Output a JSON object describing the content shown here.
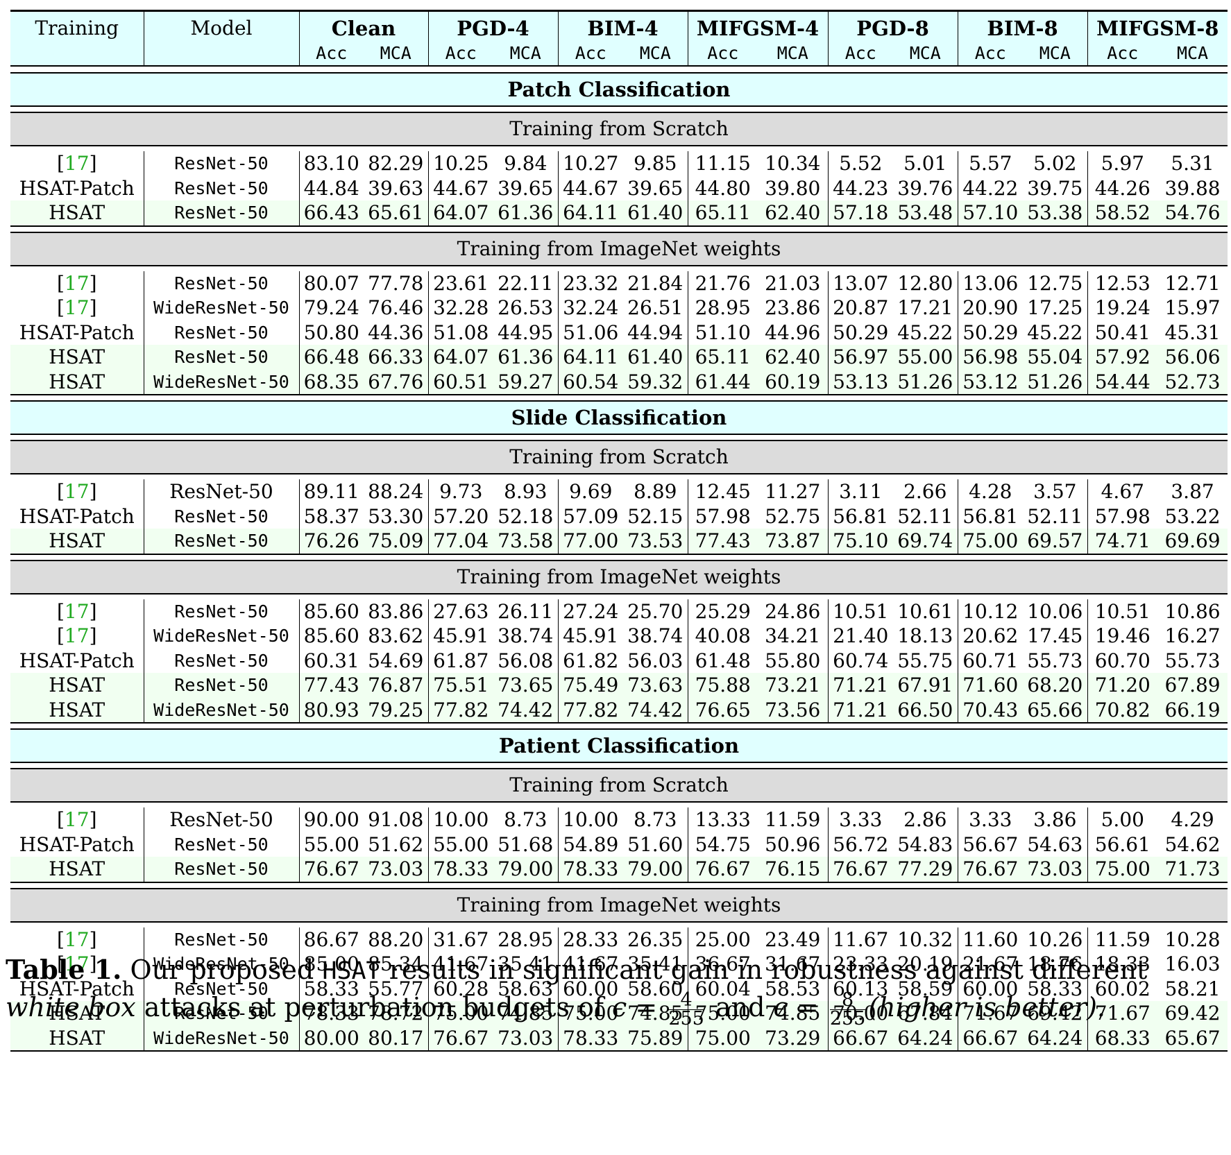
{
  "header": {
    "training_label": "Training",
    "model_label": "Model",
    "attacks": [
      "Clean",
      "PGD-4",
      "BIM-4",
      "MIFGSM-4",
      "PGD-8",
      "BIM-8",
      "MIFGSM-8"
    ],
    "metric_acc": "Acc",
    "metric_mca": "MCA"
  },
  "sections": [
    {
      "title": "Patch Classification",
      "groups": [
        {
          "title": "Training from Scratch",
          "rows": [
            {
              "training": "[17]",
              "cite": true,
              "model": "ResNet-50",
              "model_serif": false,
              "highlight": false,
              "values": [
                "83.10",
                "82.29",
                "10.25",
                "9.84",
                "10.27",
                "9.85",
                "11.15",
                "10.34",
                "5.52",
                "5.01",
                "5.57",
                "5.02",
                "5.97",
                "5.31"
              ]
            },
            {
              "training": "HSAT-Patch",
              "cite": false,
              "model": "ResNet-50",
              "model_serif": false,
              "highlight": false,
              "values": [
                "44.84",
                "39.63",
                "44.67",
                "39.65",
                "44.67",
                "39.65",
                "44.80",
                "39.80",
                "44.23",
                "39.76",
                "44.22",
                "39.75",
                "44.26",
                "39.88"
              ]
            },
            {
              "training": "HSAT",
              "cite": false,
              "model": "ResNet-50",
              "model_serif": false,
              "highlight": true,
              "values": [
                "66.43",
                "65.61",
                "64.07",
                "61.36",
                "64.11",
                "61.40",
                "65.11",
                "62.40",
                "57.18",
                "53.48",
                "57.10",
                "53.38",
                "58.52",
                "54.76"
              ]
            }
          ]
        },
        {
          "title": "Training from ImageNet weights",
          "rows": [
            {
              "training": "[17]",
              "cite": true,
              "model": "ResNet-50",
              "model_serif": false,
              "highlight": false,
              "values": [
                "80.07",
                "77.78",
                "23.61",
                "22.11",
                "23.32",
                "21.84",
                "21.76",
                "21.03",
                "13.07",
                "12.80",
                "13.06",
                "12.75",
                "12.53",
                "12.71"
              ]
            },
            {
              "training": "[17]",
              "cite": true,
              "model": "WideResNet-50",
              "model_serif": false,
              "highlight": false,
              "values": [
                "79.24",
                "76.46",
                "32.28",
                "26.53",
                "32.24",
                "26.51",
                "28.95",
                "23.86",
                "20.87",
                "17.21",
                "20.90",
                "17.25",
                "19.24",
                "15.97"
              ]
            },
            {
              "training": "HSAT-Patch",
              "cite": false,
              "model": "ResNet-50",
              "model_serif": false,
              "highlight": false,
              "values": [
                "50.80",
                "44.36",
                "51.08",
                "44.95",
                "51.06",
                "44.94",
                "51.10",
                "44.96",
                "50.29",
                "45.22",
                "50.29",
                "45.22",
                "50.41",
                "45.31"
              ]
            },
            {
              "training": "HSAT",
              "cite": false,
              "model": "ResNet-50",
              "model_serif": false,
              "highlight": true,
              "values": [
                "66.48",
                "66.33",
                "64.07",
                "61.36",
                "64.11",
                "61.40",
                "65.11",
                "62.40",
                "56.97",
                "55.00",
                "56.98",
                "55.04",
                "57.92",
                "56.06"
              ]
            },
            {
              "training": "HSAT",
              "cite": false,
              "model": "WideResNet-50",
              "model_serif": false,
              "highlight": true,
              "values": [
                "68.35",
                "67.76",
                "60.51",
                "59.27",
                "60.54",
                "59.32",
                "61.44",
                "60.19",
                "53.13",
                "51.26",
                "53.12",
                "51.26",
                "54.44",
                "52.73"
              ]
            }
          ]
        }
      ]
    },
    {
      "title": "Slide Classification",
      "groups": [
        {
          "title": "Training from Scratch",
          "rows": [
            {
              "training": "[17]",
              "cite": true,
              "model": "ResNet-50",
              "model_serif": true,
              "highlight": false,
              "values": [
                "89.11",
                "88.24",
                "9.73",
                "8.93",
                "9.69",
                "8.89",
                "12.45",
                "11.27",
                "3.11",
                "2.66",
                "4.28",
                "3.57",
                "4.67",
                "3.87"
              ]
            },
            {
              "training": "HSAT-Patch",
              "cite": false,
              "model": "ResNet-50",
              "model_serif": false,
              "highlight": false,
              "values": [
                "58.37",
                "53.30",
                "57.20",
                "52.18",
                "57.09",
                "52.15",
                "57.98",
                "52.75",
                "56.81",
                "52.11",
                "56.81",
                "52.11",
                "57.98",
                "53.22"
              ]
            },
            {
              "training": "HSAT",
              "cite": false,
              "model": "ResNet-50",
              "model_serif": false,
              "highlight": true,
              "values": [
                "76.26",
                "75.09",
                "77.04",
                "73.58",
                "77.00",
                "73.53",
                "77.43",
                "73.87",
                "75.10",
                "69.74",
                "75.00",
                "69.57",
                "74.71",
                "69.69"
              ]
            }
          ]
        },
        {
          "title": "Training from ImageNet weights",
          "rows": [
            {
              "training": "[17]",
              "cite": true,
              "model": "ResNet-50",
              "model_serif": false,
              "highlight": false,
              "values": [
                "85.60",
                "83.86",
                "27.63",
                "26.11",
                "27.24",
                "25.70",
                "25.29",
                "24.86",
                "10.51",
                "10.61",
                "10.12",
                "10.06",
                "10.51",
                "10.86"
              ]
            },
            {
              "training": "[17]",
              "cite": true,
              "model": "WideResNet-50",
              "model_serif": false,
              "highlight": false,
              "values": [
                "85.60",
                "83.62",
                "45.91",
                "38.74",
                "45.91",
                "38.74",
                "40.08",
                "34.21",
                "21.40",
                "18.13",
                "20.62",
                "17.45",
                "19.46",
                "16.27"
              ]
            },
            {
              "training": "HSAT-Patch",
              "cite": false,
              "model": "ResNet-50",
              "model_serif": false,
              "highlight": false,
              "values": [
                "60.31",
                "54.69",
                "61.87",
                "56.08",
                "61.82",
                "56.03",
                "61.48",
                "55.80",
                "60.74",
                "55.75",
                "60.71",
                "55.73",
                "60.70",
                "55.73"
              ]
            },
            {
              "training": "HSAT",
              "cite": false,
              "model": "ResNet-50",
              "model_serif": false,
              "highlight": true,
              "values": [
                "77.43",
                "76.87",
                "75.51",
                "73.65",
                "75.49",
                "73.63",
                "75.88",
                "73.21",
                "71.21",
                "67.91",
                "71.60",
                "68.20",
                "71.20",
                "67.89"
              ]
            },
            {
              "training": "HSAT",
              "cite": false,
              "model": "WideResNet-50",
              "model_serif": false,
              "highlight": true,
              "values": [
                "80.93",
                "79.25",
                "77.82",
                "74.42",
                "77.82",
                "74.42",
                "76.65",
                "73.56",
                "71.21",
                "66.50",
                "70.43",
                "65.66",
                "70.82",
                "66.19"
              ]
            }
          ]
        }
      ]
    },
    {
      "title": "Patient Classification",
      "groups": [
        {
          "title": "Training from Scratch",
          "rows": [
            {
              "training": "[17]",
              "cite": true,
              "model": "ResNet-50",
              "model_serif": true,
              "highlight": false,
              "values": [
                "90.00",
                "91.08",
                "10.00",
                "8.73",
                "10.00",
                "8.73",
                "13.33",
                "11.59",
                "3.33",
                "2.86",
                "3.33",
                "3.86",
                "5.00",
                "4.29"
              ]
            },
            {
              "training": "HSAT-Patch",
              "cite": false,
              "model": "ResNet-50",
              "model_serif": false,
              "highlight": false,
              "values": [
                "55.00",
                "51.62",
                "55.00",
                "51.68",
                "54.89",
                "51.60",
                "54.75",
                "50.96",
                "56.72",
                "54.83",
                "56.67",
                "54.63",
                "56.61",
                "54.62"
              ]
            },
            {
              "training": "HSAT",
              "cite": false,
              "model": "ResNet-50",
              "model_serif": false,
              "highlight": true,
              "values": [
                "76.67",
                "73.03",
                "78.33",
                "79.00",
                "78.33",
                "79.00",
                "76.67",
                "76.15",
                "76.67",
                "77.29",
                "76.67",
                "73.03",
                "75.00",
                "71.73"
              ]
            }
          ]
        },
        {
          "title": "Training from ImageNet weights",
          "rows": [
            {
              "training": "[17]",
              "cite": true,
              "model": "ResNet-50",
              "model_serif": false,
              "highlight": false,
              "values": [
                "86.67",
                "88.20",
                "31.67",
                "28.95",
                "28.33",
                "26.35",
                "25.00",
                "23.49",
                "11.67",
                "10.32",
                "11.60",
                "10.26",
                "11.59",
                "10.28"
              ]
            },
            {
              "training": "[17]",
              "cite": true,
              "model": "WideResNet-50",
              "model_serif": false,
              "highlight": false,
              "values": [
                "85.00",
                "85.34",
                "41.67",
                "35.41",
                "41.67",
                "35.41",
                "36.67",
                "31.67",
                "23.33",
                "20.19",
                "21.67",
                "18.76",
                "18.33",
                "16.03"
              ]
            },
            {
              "training": "HSAT-Patch",
              "cite": false,
              "model": "ResNet-50",
              "model_serif": false,
              "highlight": false,
              "values": [
                "58.33",
                "55.77",
                "60.28",
                "58.63",
                "60.00",
                "58.60",
                "60.04",
                "58.53",
                "60.13",
                "58.59",
                "60.00",
                "58.33",
                "60.02",
                "58.21"
              ]
            },
            {
              "training": "HSAT",
              "cite": false,
              "model": "ResNet-50",
              "model_serif": false,
              "highlight": true,
              "values": [
                "78.33",
                "78.72",
                "75.00",
                "74.85",
                "75.00",
                "74.85",
                "75.00",
                "74.85",
                "70.00",
                "67.84",
                "71.67",
                "69.42",
                "71.67",
                "69.42"
              ]
            },
            {
              "training": "HSAT",
              "cite": false,
              "model": "WideResNet-50",
              "model_serif": false,
              "highlight": true,
              "values": [
                "80.00",
                "80.17",
                "76.67",
                "73.03",
                "78.33",
                "75.89",
                "75.00",
                "73.29",
                "66.67",
                "64.24",
                "66.67",
                "64.24",
                "68.33",
                "65.67"
              ]
            }
          ]
        }
      ]
    }
  ],
  "caption": {
    "label": "Table 1.",
    "text_1": "Our proposed",
    "method": "HSAT",
    "text_2": "results in significant gain in robustness against different",
    "italic_1": "white box",
    "text_3": "attacks at perturbation budgets of",
    "eps_symbol": "ϵ =",
    "frac1_num": "4",
    "frac1_den": "255",
    "text_and": "and",
    "frac2_num": "8",
    "frac2_den": "255",
    "italic_2": "(higher is better)."
  },
  "colors": {
    "header_bg": "#e0ffff",
    "subheader_bg": "#dcdcdc",
    "highlight_row_bg": "#f1fff1",
    "cite_color": "#22aa22"
  }
}
